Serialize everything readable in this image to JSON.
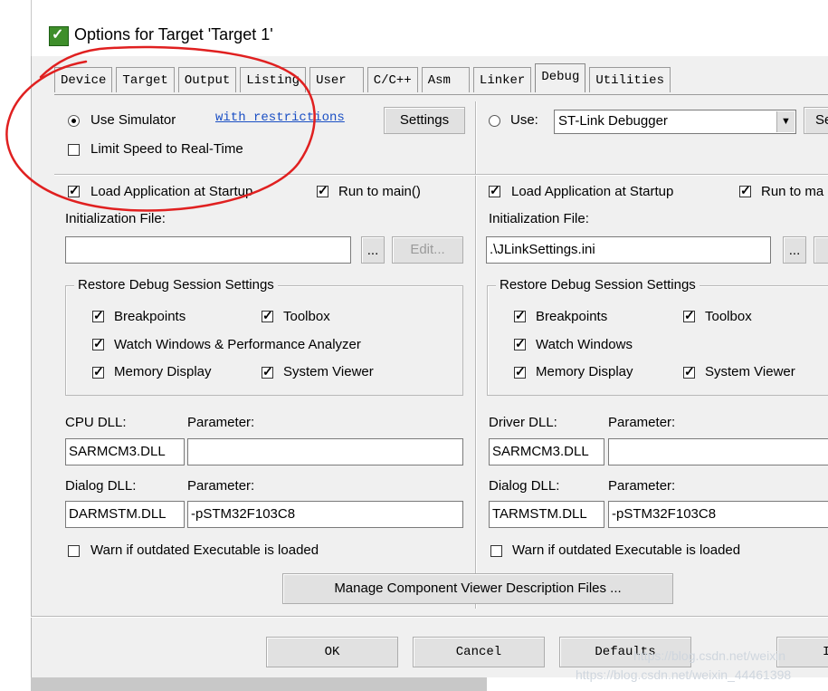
{
  "window": {
    "title": "Options for Target 'Target 1'"
  },
  "tabs": [
    "Device",
    "Target",
    "Output",
    "Listing",
    "User",
    "C/C++",
    "Asm",
    "Linker",
    "Debug",
    "Utilities"
  ],
  "active_tab": "Debug",
  "left": {
    "use_simulator": "Use Simulator",
    "with_restrictions": "with restrictions",
    "settings": "Settings",
    "limit_speed": "Limit Speed to Real-Time",
    "load_app": "Load Application at Startup",
    "run_to_main": "Run to main()",
    "init_file_label": "Initialization File:",
    "init_file_value": "",
    "browse": "...",
    "edit": "Edit...",
    "restore_group": "Restore Debug Session Settings",
    "breakpoints": "Breakpoints",
    "toolbox": "Toolbox",
    "watch_windows": "Watch Windows & Performance Analyzer",
    "memory_display": "Memory Display",
    "system_viewer": "System Viewer",
    "cpu_dll_label": "CPU DLL:",
    "cpu_param_label": "Parameter:",
    "cpu_dll": "SARMCM3.DLL",
    "cpu_param": "",
    "dialog_dll_label": "Dialog DLL:",
    "dialog_param_label": "Parameter:",
    "dialog_dll": "DARMSTM.DLL",
    "dialog_param": "-pSTM32F103C8",
    "warn": "Warn if outdated Executable is loaded"
  },
  "right": {
    "use": "Use:",
    "debugger": "ST-Link Debugger",
    "settings_partial": "Se",
    "load_app": "Load Application at Startup",
    "run_to_main": "Run to ma",
    "init_file_label": "Initialization File:",
    "init_file_value": ".\\JLinkSettings.ini",
    "browse": "...",
    "restore_group": "Restore Debug Session Settings",
    "breakpoints": "Breakpoints",
    "toolbox": "Toolbox",
    "watch_windows": "Watch Windows",
    "memory_display": "Memory Display",
    "system_viewer": "System Viewer",
    "driver_dll_label": "Driver DLL:",
    "driver_param_label": "Parameter:",
    "driver_dll": "SARMCM3.DLL",
    "driver_param": "",
    "dialog_dll_label": "Dialog DLL:",
    "dialog_param_label": "Parameter:",
    "dialog_dll": "TARMSTM.DLL",
    "dialog_param": "-pSTM32F103C8",
    "warn": "Warn if outdated Executable is loaded"
  },
  "manage_button": "Manage Component Viewer Description Files ...",
  "footer": {
    "ok": "OK",
    "cancel": "Cancel",
    "defaults": "Defaults",
    "help_partial": "I"
  },
  "watermark": {
    "line1": "https://blog.csdn.net/weixin",
    "line2": "https://blog.csdn.net/weixin_44461398"
  },
  "colors": {
    "annotation": "#e02020",
    "link": "#1a4fc4",
    "dialog_bg": "#f0f0f0"
  }
}
